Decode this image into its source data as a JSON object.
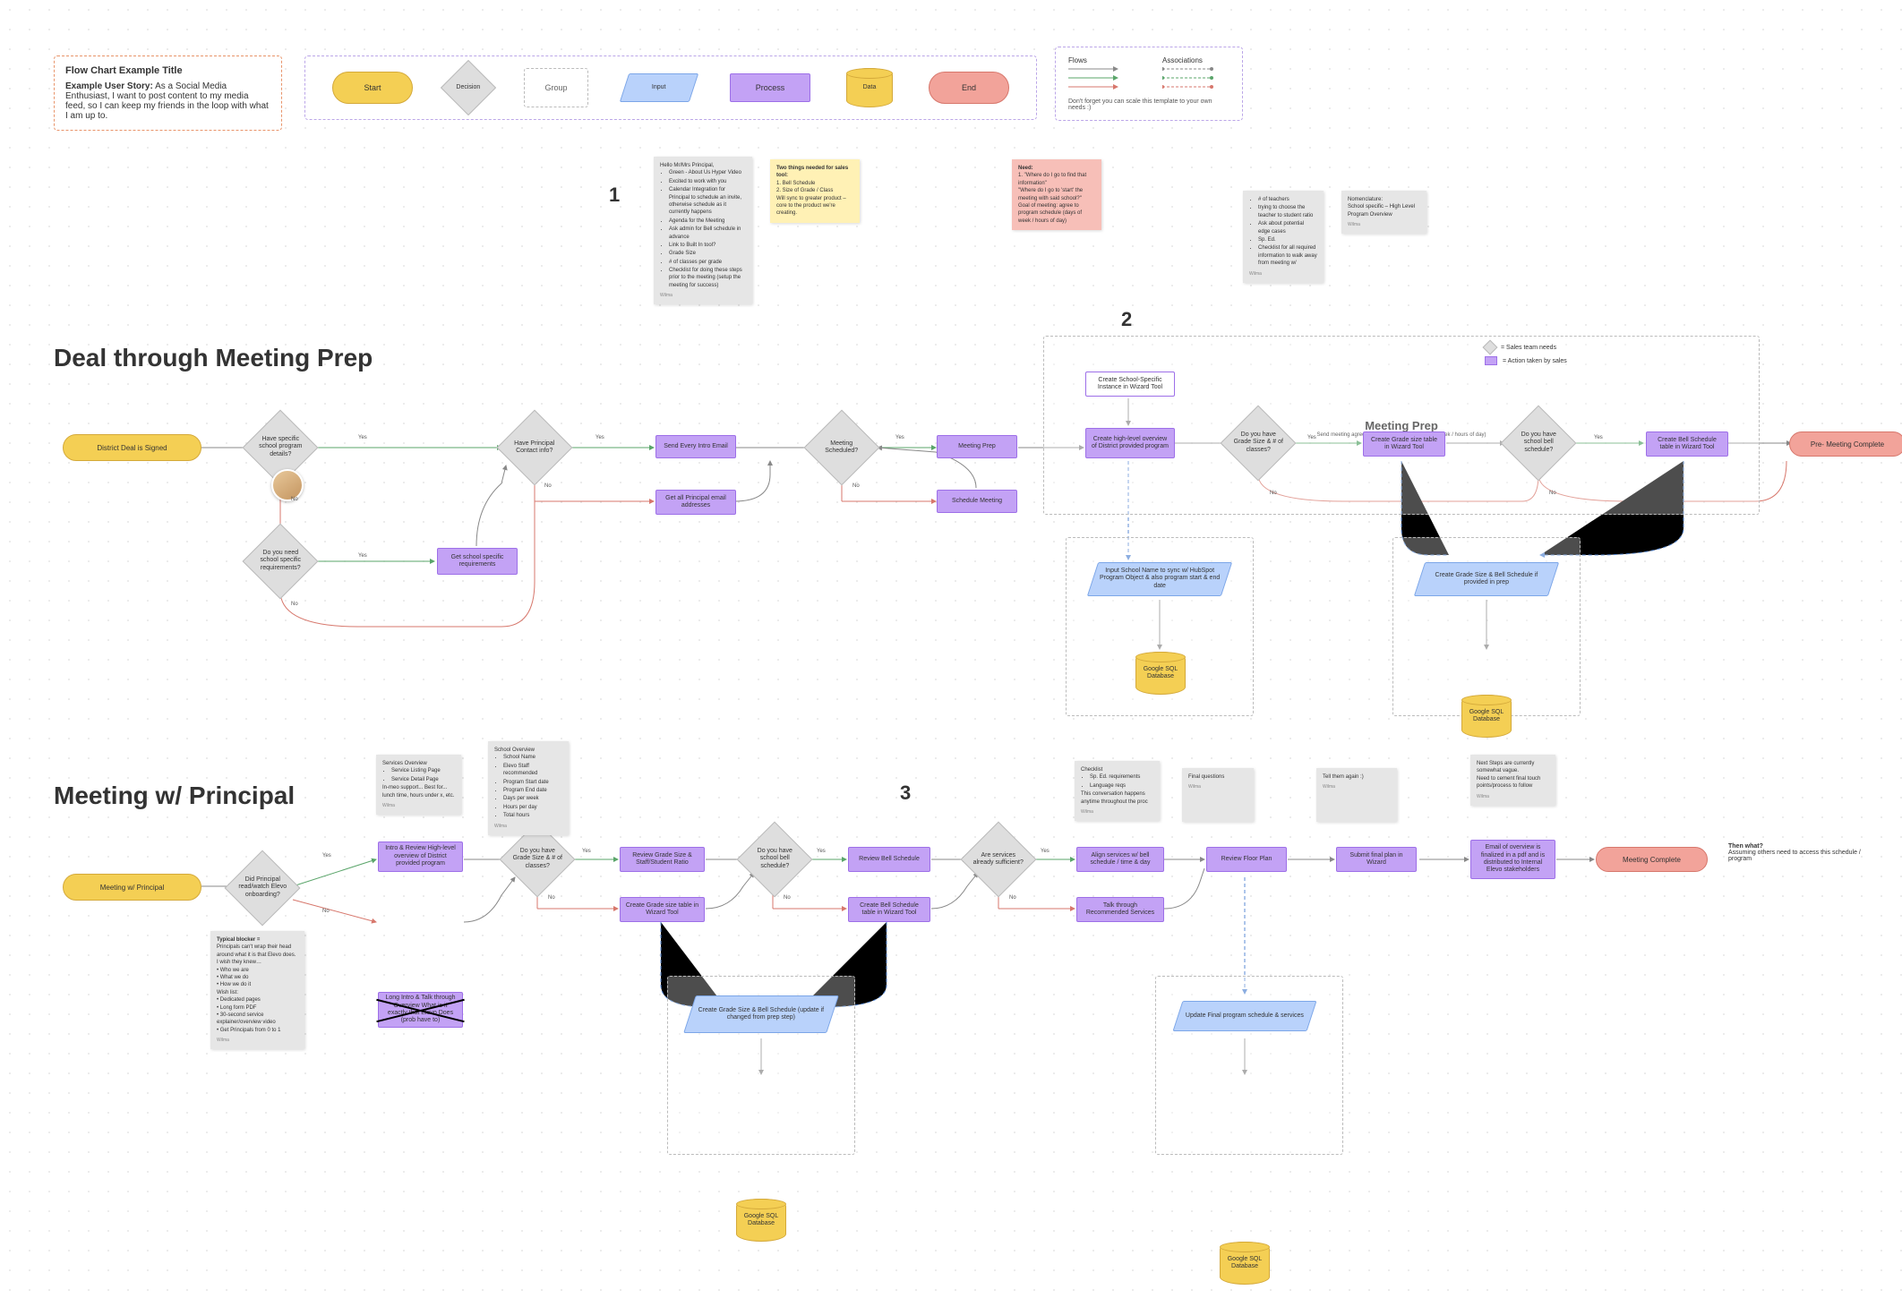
{
  "legend": {
    "title": "Flow Chart Example Title",
    "story_label": "Example User Story:",
    "story_text": "As a Social Media Enthusiast, I want to post content to my media feed, so I can keep my friends in the loop with what I am up to.",
    "shapes": {
      "start": "Start",
      "decision": "Decision",
      "group": "Group",
      "input": "Input",
      "process": "Process",
      "data": "Data",
      "end": "End"
    },
    "flows_header": "Flows",
    "assoc_header": "Associations",
    "footer_note": "Don't forget you can scale this template to your own needs :)"
  },
  "section1_title": "Deal through Meeting Prep",
  "section2_title": "Meeting w/ Principal",
  "numbers": {
    "one": "1",
    "two": "2",
    "three": "3"
  },
  "meeting_prep_group": {
    "title": "Meeting Prep",
    "subtitle": "Send meeting agree to program schedule (days of week / hours of day)",
    "legend_sales": "= Sales team needs",
    "legend_action": "= Action taken by sales"
  },
  "flow1": {
    "start": "District Deal is Signed",
    "d_have_school_details": "Have specific school program details?",
    "d_need_school_req": "Do you need school specific requirements?",
    "p_get_school_req": "Get school specific requirements",
    "d_have_principal": "Have Principal Contact info?",
    "p_send_intro": "Send Every Intro Email",
    "p_get_emails": "Get all Principal email addresses",
    "d_meeting_scheduled": "Meeting Scheduled?",
    "p_meeting_prep": "Meeting Prep",
    "p_schedule_meeting": "Schedule Meeting",
    "p_create_school_instance": "Create School-Specific Instance in Wizard Tool",
    "p_create_high_level": "Create high-level overview of District provided program",
    "d_have_grade_size": "Do you have Grade Size & # of classes?",
    "p_create_grade_table": "Create Grade size table in Wizard Tool",
    "d_have_bell": "Do you have school bell schedule?",
    "p_create_bell": "Create Bell Schedule table in Wizard Tool",
    "end": "Pre- Meeting Complete",
    "input_school_name": "Input School Name to sync w/ HubSpot Program Object & also program start & end date",
    "input_grade_bell": "Create Grade Size & Bell Schedule if provided in prep",
    "data1": "Google SQL Database",
    "data2": "Google SQL Database"
  },
  "yn": {
    "yes": "Yes",
    "no": "No"
  },
  "stickies_top": {
    "email_script": {
      "title": "Hello Mr/Mrs Principal,",
      "bullets": [
        "Green - About Us Hyper Video",
        "Excited to work with you",
        "Calendar Integration for Principal to schedule an invite, otherwise schedule as it currently happens",
        "Agenda for the Meeting",
        "Ask admin for Bell schedule in advance",
        "Link to Built In tool?",
        "Grade Size",
        "# of classes per grade",
        "Checklist for doing these steps prior to the meeting (setup the meeting for success)"
      ],
      "att": "Wilma"
    },
    "two_things": {
      "title": "Two things needed for sales tool:",
      "lines": [
        "1. Bell Schedule",
        "2. Size of Grade / Class",
        "",
        "Will sync to greater product – core to the product we're creating."
      ]
    },
    "need": {
      "title": "Need:",
      "lines": [
        "1. \"Where do I go to find that information\"",
        "\"Where do I go to 'start' the meeting with said school?\"",
        "Goal of meeting: agree to program schedule (days of week / hours of day)"
      ]
    },
    "teachers": {
      "bullets": [
        "# of teachers",
        "trying to choose the teacher to student ratio",
        "Ask about potential edge cases",
        "Sp. Ed.",
        "Checklist for all required information to walk away from meeting w/"
      ],
      "att": "Wilma"
    },
    "nomenclature": {
      "title": "Nomenclature:",
      "line": "School specific – High Level Program Overview",
      "att": "Wilma"
    }
  },
  "flow2": {
    "start": "Meeting w/ Principal",
    "d_did_principal_watch": "Did Principal read/watch Elevo onboarding?",
    "p_intro_review": "Intro & Review High-level overview of District provided program",
    "p_long_intro": "Long Intro & Talk through Overview What is it exactly that Elevo Does (prob have to)",
    "d_grade_size2": "Do you have Grade Size & # of classes?",
    "p_review_grade": "Review Grade Size & Staff/Student Ratio",
    "p_create_grade2": "Create Grade size table in Wizard Tool",
    "d_bell2": "Do you have school bell schedule?",
    "p_review_bell": "Review Bell Schedule",
    "p_create_bell2": "Create Bell Schedule table in Wizard Tool",
    "d_services_enough": "Are services already sufficient?",
    "p_align_services": "Align services w/ bell schedule / time & day",
    "p_talk_recommended": "Talk through Recommended Services",
    "p_review_floor": "Review Floor Plan",
    "p_submit_floor": "Submit final plan in Wizard",
    "p_email_overview": "Email of overview is finalized in a pdf and is distributed to Internal Elevo stakeholders",
    "end": "Meeting Complete",
    "input_grade_bell2": "Create Grade Size & Bell Schedule (update if changed from prep step)",
    "input_update_final": "Update Final program schedule & services",
    "data1": "Google SQL Database",
    "data2": "Google SQL Database",
    "then_what_title": "Then what?",
    "then_what_text": "Assuming others need to access this schedule / program"
  },
  "stickies_bottom": {
    "blocker": {
      "title": "Typical blocker =",
      "lines": [
        "Principals can't wrap their head around what it is that Elevo does.",
        "I wish they knew…",
        "• Who we are",
        "• What we do",
        "• How we do it",
        "Wish list:",
        "• Dedicated pages",
        "• Long form PDF",
        "• 30-second service explainer/overview video",
        "• Get Principals from 0 to 1"
      ],
      "att": "Wilma"
    },
    "services_overview": {
      "title": "Services Overview",
      "bullets": [
        "Service Listing Page",
        "Service Detail Page"
      ],
      "extra": "In-meo support... Best for... lunch time, hours under x, etc.",
      "att": "Wilma"
    },
    "school_overview": {
      "title": "School Overview",
      "bullets": [
        "School Name",
        "Elevo Staff recommended",
        "Program Start date",
        "Program End date",
        "Days per week",
        "Hours per day",
        "Total hours"
      ],
      "att": "Wilma"
    },
    "checklist": {
      "title": "Checklist",
      "bullets": [
        "Sp. Ed. requirements",
        "Language reqs"
      ],
      "extra": "This conversation happens anytime throughout the proc",
      "att": "Wilma"
    },
    "final_questions": {
      "text": "Final questions",
      "att": "Wilma"
    },
    "tell_again": {
      "text": "Tell them again :)",
      "att": "Wilma"
    },
    "next_steps": {
      "lines": [
        "Next Steps are currently somewhat vague.",
        "Need to cement final touch points/process to follow"
      ],
      "att": "Wilma"
    }
  }
}
